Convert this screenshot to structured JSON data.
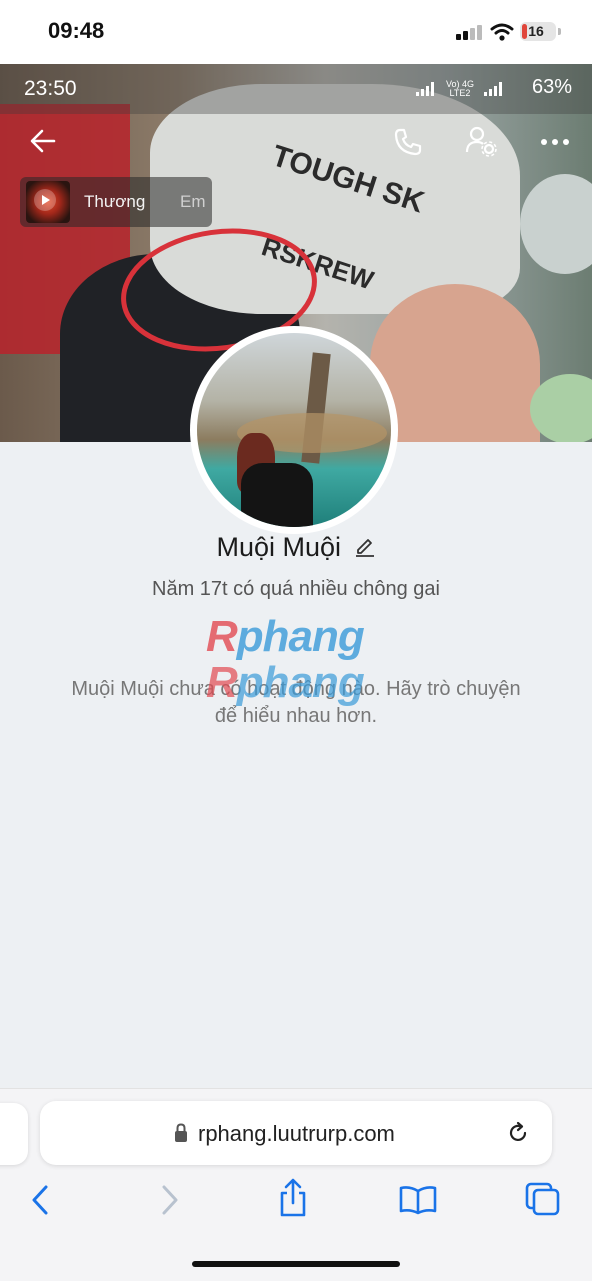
{
  "ios_status": {
    "time": "09:48",
    "battery": "16"
  },
  "inner_status": {
    "time": "23:50",
    "net_vo": "Vo)",
    "net_lte": "LTE2",
    "net_4g": "4G",
    "battery": "63%"
  },
  "music": {
    "title": "Thương",
    "next": "Em"
  },
  "profile": {
    "name": "Muội Muội",
    "bio": "Năm 17t có quá nhiều chông gai",
    "empty_message": "Muội Muội chưa có hoạt động nào. Hãy trò chuyện để hiểu nhau hơn."
  },
  "watermark": {
    "first_letter": "R",
    "rest": "phang"
  },
  "safari": {
    "url": "rphang.luutrurp.com"
  },
  "icons": [
    "back-arrow-icon",
    "phone-icon",
    "user-settings-icon",
    "more-icon",
    "play-icon",
    "edit-icon",
    "lock-icon",
    "reload-icon",
    "chevron-left-icon",
    "chevron-right-icon",
    "share-icon",
    "bookmarks-icon",
    "tabs-icon"
  ],
  "colors": {
    "watermark_blue": "#3a9bd9",
    "watermark_red": "#e24a52",
    "page_bg": "#edf0f3",
    "safari_blue": "#1a73e8"
  }
}
